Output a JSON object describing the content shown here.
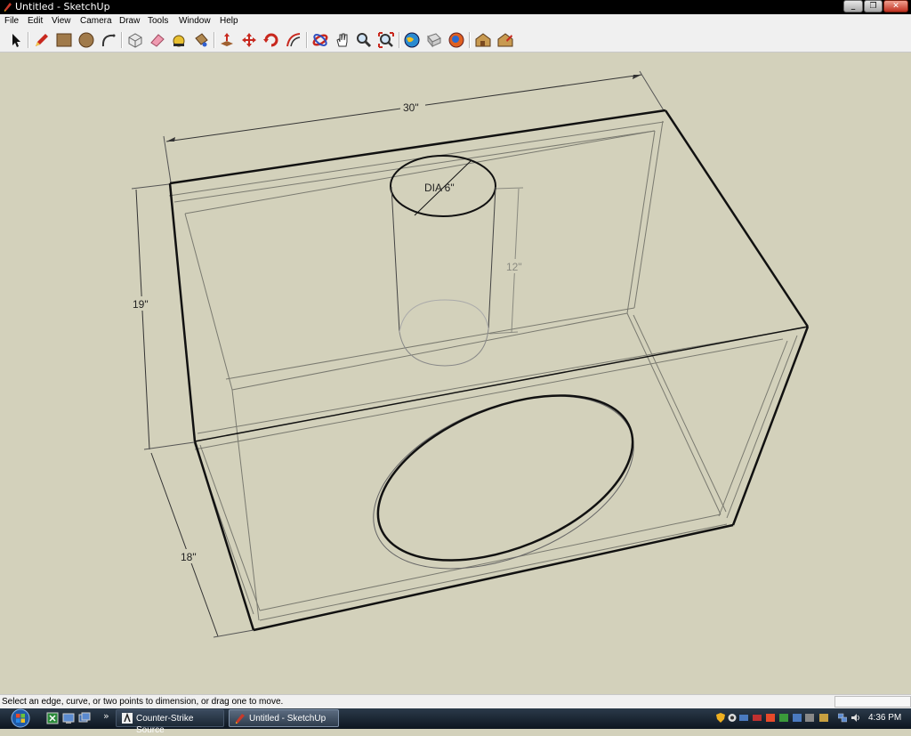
{
  "window": {
    "title": "Untitled - SketchUp",
    "controls": [
      "minimize",
      "maximize",
      "close"
    ]
  },
  "menu": [
    "File",
    "Edit",
    "View",
    "Camera",
    "Draw",
    "Tools",
    "Window",
    "Help"
  ],
  "toolbar": {
    "tools": [
      "select-tool",
      "line-tool",
      "rectangle-tool",
      "circle-tool",
      "arc-tool",
      "make-component-tool",
      "eraser-tool",
      "tape-measure-tool",
      "paint-bucket-tool",
      "push-pull-tool",
      "move-tool",
      "rotate-tool",
      "offset-tool",
      "orbit-tool",
      "pan-tool",
      "zoom-tool",
      "zoom-extents-tool",
      "get-models-tool",
      "share-model-tool",
      "share-component-tool",
      "get-photo-texture-tool",
      "component-options-tool"
    ]
  },
  "drawing": {
    "dimensions": {
      "width": "30\"",
      "height": "19\"",
      "depth": "18\"",
      "port_diameter": "DIA 6\"",
      "port_length": "12\""
    }
  },
  "status": {
    "message": "Select an edge, curve, or two points to dimension, or drag one to move."
  },
  "taskbar": {
    "buttons": [
      {
        "label": "Counter-Strike Source",
        "active": false
      },
      {
        "label": "Untitled - SketchUp",
        "active": true
      }
    ],
    "clock": "4:36 PM"
  }
}
